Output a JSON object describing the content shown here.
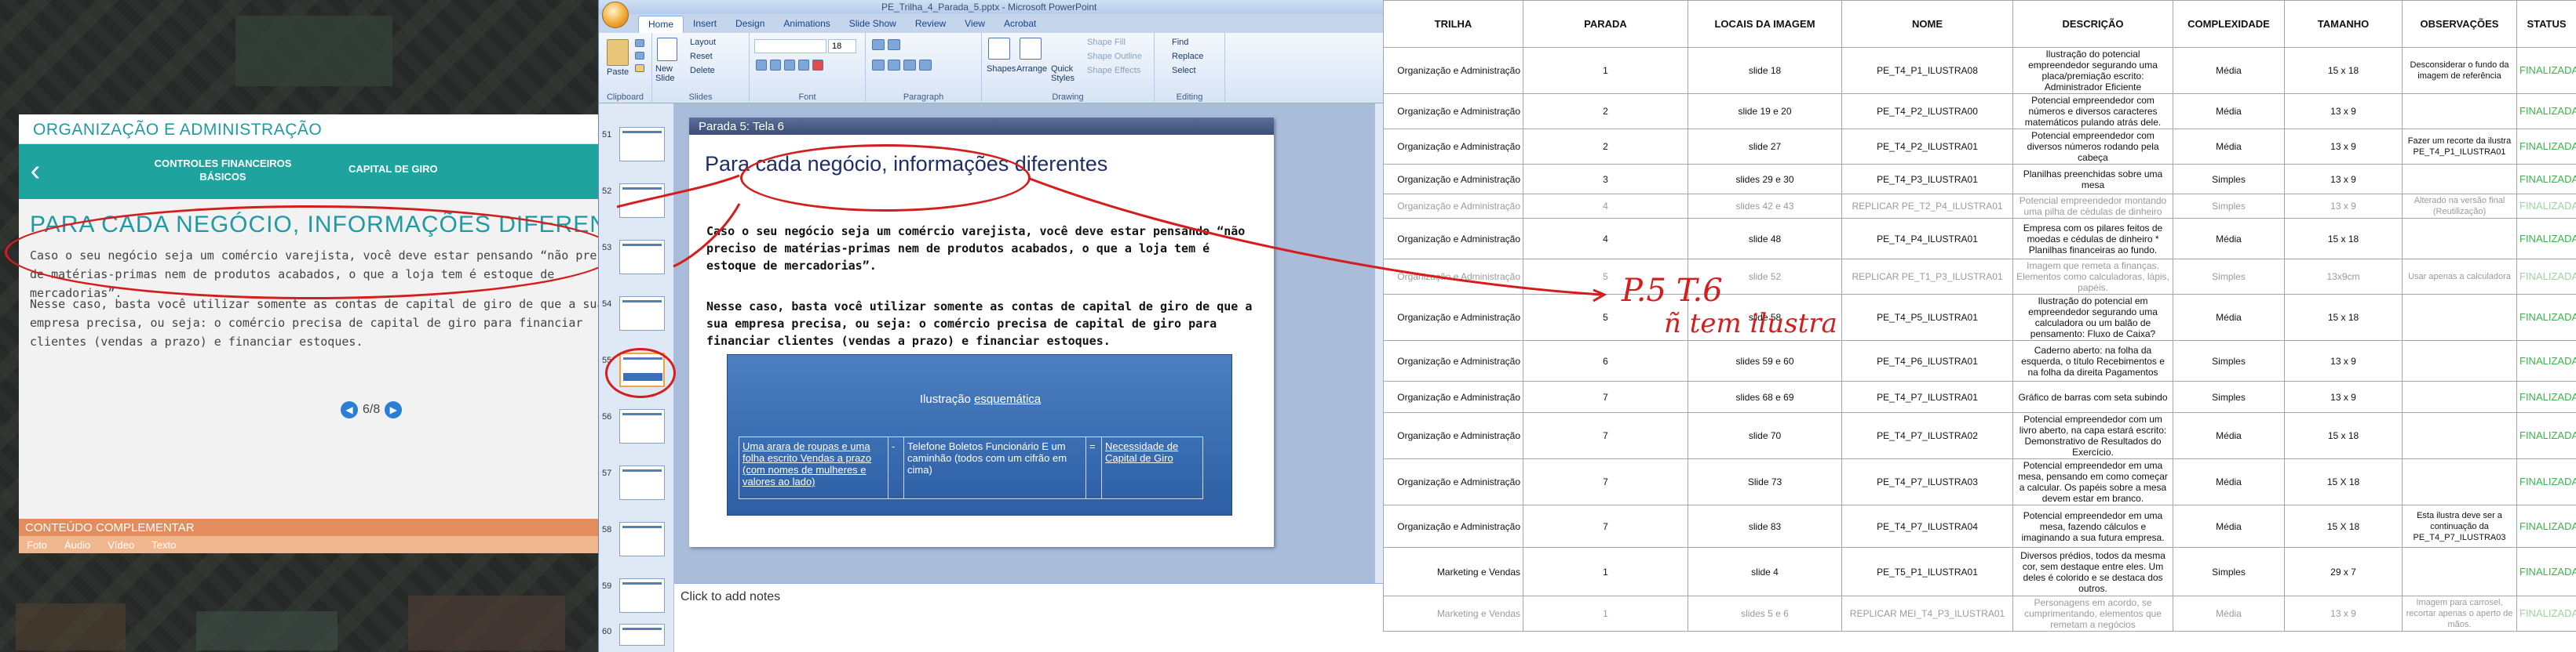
{
  "viewer": {
    "section_title": "ORGANIZAÇÃO E ADMINISTRAÇÃO",
    "nav_back": "‹",
    "nav_item1": "CONTROLES FINANCEIROS BÁSICOS",
    "nav_item2": "CAPITAL DE GIRO",
    "slide_title": "PARA CADA NEGÓCIO, INFORMAÇÕES DIFERENTES",
    "para1": "Caso o seu negócio seja um comércio varejista, você deve estar pensando “não preciso de matérias-primas nem de produtos acabados, o que a loja tem é estoque de mercadorias”.",
    "para2": "Nesse caso, basta você utilizar somente as contas de capital de giro de que a sua empresa precisa, ou seja: o comércio precisa de capital de giro para financiar clientes (vendas a prazo) e financiar estoques.",
    "pager_prev": "◀",
    "pager_text": "6/8",
    "pager_next": "▶",
    "footer_label": "CONTEÚDO COMPLEMENTAR",
    "footer_items": [
      "Foto",
      "Áudio",
      "Vídeo",
      "Texto"
    ]
  },
  "ppt": {
    "window_title": "PE_Trilha_4_Parada_5.pptx - Microsoft PowerPoint",
    "tabs": [
      "Home",
      "Insert",
      "Design",
      "Animations",
      "Slide Show",
      "Review",
      "View",
      "Acrobat"
    ],
    "groups": [
      "Clipboard",
      "Slides",
      "Font",
      "Paragraph",
      "Drawing",
      "Editing"
    ],
    "ribbon": {
      "paste": "Paste",
      "new_slide": "New Slide",
      "layout": "Layout",
      "reset": "Reset",
      "delete": "Delete",
      "font_size": "18",
      "shapes": "Shapes",
      "arrange": "Arrange",
      "quick_styles": "Quick Styles",
      "shape_fill": "Shape Fill",
      "shape_outline": "Shape Outline",
      "shape_effects": "Shape Effects",
      "find": "Find",
      "replace": "Replace",
      "select": "Select"
    },
    "thumb_numbers": [
      "51",
      "52",
      "53",
      "54",
      "55",
      "56",
      "57",
      "58",
      "59",
      "60"
    ],
    "slide": {
      "bar_title": "Parada 5: Tela 6",
      "title": "Para cada negócio, informações diferentes",
      "para1": "Caso o seu negócio seja um comércio varejista, você deve estar pensando “não preciso de matérias-primas nem de produtos acabados, o que a loja tem é estoque de mercadorias”.",
      "para2": "Nesse caso, basta você utilizar somente as contas de capital de giro de que a sua empresa precisa, ou seja: o comércio precisa de capital de giro para financiar clientes (vendas a prazo) e financiar estoques.",
      "illu_prefix": "Ilustração",
      "illu_word": "esquemática",
      "cell1": "Uma arara de roupas e uma folha escrito Vendas a prazo (com nomes de mulheres e valores ao lado)",
      "cell2": "-",
      "cell3": "Telefone Boletos Funcionário E um caminhão (todos com um cifrão em cima)",
      "cell4": "=",
      "cell5": "Necessidade de Capital de Giro"
    },
    "notes_placeholder": "Click to add notes"
  },
  "sheet": {
    "headers": [
      "TRILHA",
      "PARADA",
      "LOCAIS DA IMAGEM",
      "NOME",
      "DESCRIÇÃO",
      "COMPLEXIDADE",
      "TAMANHO",
      "OBSERVAÇÕES",
      "STATUS"
    ],
    "rows": [
      {
        "trilha": "Organização e Administração",
        "parada": "1",
        "locais": "slide 18",
        "nome": "PE_T4_P1_ILUSTRA08",
        "desc": "Ilustração do potencial empreendedor segurando uma placa/premiação escrito: Administrador Eficiente",
        "compl": "Média",
        "tam": "15 x 18",
        "obs": "Desconsiderar o fundo da imagem de referência",
        "status": "FINALIZADA",
        "gray": false,
        "h": 52
      },
      {
        "trilha": "Organização e Administração",
        "parada": "2",
        "locais": "slide 19 e 20",
        "nome": "PE_T4_P2_ILUSTRA00",
        "desc": "Potencial empreendedor com números e diversos caracteres matemáticos pulando atrás dele.",
        "compl": "Média",
        "tam": "13 x 9",
        "obs": "",
        "status": "FINALIZADA",
        "gray": false,
        "h": 40
      },
      {
        "trilha": "Organização e Administração",
        "parada": "2",
        "locais": "slide 27",
        "nome": "PE_T4_P2_ILUSTRA01",
        "desc": "Potencial empreendedor com diversos números rodando pela cabeça",
        "compl": "Média",
        "tam": "13 x 9",
        "obs": "Fazer um recorte da ilustra PE_T4_P1_ILUSTRA01",
        "status": "FINALIZADA",
        "gray": false,
        "h": 40
      },
      {
        "trilha": "Organização e Administração",
        "parada": "3",
        "locais": "slides 29 e 30",
        "nome": "PE_T4_P3_ILUSTRA01",
        "desc": "Planilhas preenchidas sobre uma mesa",
        "compl": "Simples",
        "tam": "13 x 9",
        "obs": "",
        "status": "FINALIZADA",
        "gray": false,
        "h": 38
      },
      {
        "trilha": "Organização e Administração",
        "parada": "4",
        "locais": "slides 42 e 43",
        "nome": "REPLICAR PE_T2_P4_ILUSTRA01",
        "desc": "Potencial empreendedor montando uma pilha de cédulas de dinheiro",
        "compl": "Simples",
        "tam": "13 x 9",
        "obs": "Alterado na versão final (Reutilização)",
        "status": "FINALIZADA",
        "gray": true,
        "h": 30
      },
      {
        "trilha": "Organização e Administração",
        "parada": "4",
        "locais": "slide 48",
        "nome": "PE_T4_P4_ILUSTRA01",
        "desc": "Empresa com os pilares feitos de moedas e cédulas de dinheiro * Planilhas financeiras ao fundo.",
        "compl": "Média",
        "tam": "15 x 18",
        "obs": "",
        "status": "FINALIZADA",
        "gray": false,
        "h": 52
      },
      {
        "trilha": "Organização e Administração",
        "parada": "5",
        "locais": "slide 52",
        "nome": "REPLICAR PE_T1_P3_ILUSTRA01",
        "desc": "Imagem que remeta a finanças. Elementos como calculadoras, lápis, papéis.",
        "compl": "Simples",
        "tam": "13x9cm",
        "obs": "Usar apenas a calculadora",
        "status": "FINALIZADA",
        "gray": true,
        "h": 42
      },
      {
        "trilha": "Organização e Administração",
        "parada": "5",
        "locais": "slide 58",
        "nome": "PE_T4_P5_ILUSTRA01",
        "desc": "Ilustração do potencial em empreendedor segurando uma calculadora ou um balão de pensamento: Fluxo de Caixa?",
        "compl": "Média",
        "tam": "15 x 18",
        "obs": "",
        "status": "FINALIZADA",
        "gray": false,
        "h": 54
      },
      {
        "trilha": "Organização e Administração",
        "parada": "6",
        "locais": "slides 59 e 60",
        "nome": "PE_T4_P6_ILUSTRA01",
        "desc": "Caderno aberto: na folha da esquerda, o título Recebimentos e na folha da direita Pagamentos",
        "compl": "Simples",
        "tam": "13 x 9",
        "obs": "",
        "status": "FINALIZADA",
        "gray": false,
        "h": 52
      },
      {
        "trilha": "Organização e Administração",
        "parada": "7",
        "locais": "slides 68 e 69",
        "nome": "PE_T4_P7_ILUSTRA01",
        "desc": "Gráfico de barras com seta subindo",
        "compl": "Simples",
        "tam": "13 x 9",
        "obs": "",
        "status": "FINALIZADA",
        "gray": false,
        "h": 40
      },
      {
        "trilha": "Organização e Administração",
        "parada": "7",
        "locais": "slide 70",
        "nome": "PE_T4_P7_ILUSTRA02",
        "desc": "Potencial empreendedor com um livro aberto, na capa estará escrito: Demonstrativo de Resultados do Exercício.",
        "compl": "Média",
        "tam": "15 x 18",
        "obs": "",
        "status": "FINALIZADA",
        "gray": false,
        "h": 58
      },
      {
        "trilha": "Organização e Administração",
        "parada": "7",
        "locais": "Slide 73",
        "nome": "PE_T4_P7_ILUSTRA03",
        "desc": "Potencial empreendedor em uma mesa, pensando em como começar a calcular. Os papéis sobre a mesa devem estar em branco.",
        "compl": "Média",
        "tam": "15 X 18",
        "obs": "",
        "status": "FINALIZADA",
        "gray": false,
        "h": 58
      },
      {
        "trilha": "Organização e Administração",
        "parada": "7",
        "locais": "slide 83",
        "nome": "PE_T4_P7_ILUSTRA04",
        "desc": "Potencial empreendedor em uma mesa, fazendo cálculos e imaginando a sua futura empresa.",
        "compl": "Média",
        "tam": "15 X 18",
        "obs": "Esta ilustra deve ser a continuação da PE_T4_P7_ILUSTRA03",
        "status": "FINALIZADA",
        "gray": false,
        "h": 54
      },
      {
        "trilha": "Marketing e Vendas",
        "parada": "1",
        "locais": "slide 4",
        "nome": "PE_T5_P1_ILUSTRA01",
        "desc": "Diversos prédios, todos da mesma cor, sem destaque entre eles. Um deles é colorido e se destaca dos outros.",
        "compl": "Simples",
        "tam": "29 x 7",
        "obs": "",
        "status": "FINALIZADA",
        "gray": false,
        "h": 62
      },
      {
        "trilha": "Marketing e Vendas",
        "parada": "1",
        "locais": "slides 5 e 6",
        "nome": "REPLICAR MEI_T4_P3_ILUSTRA01",
        "desc": "Personagens em acordo, se cumprimentando, elementos que remetam a negócios",
        "compl": "Média",
        "tam": "13 x 9",
        "obs": "Imagem para carrosel, recortar apenas o aperto de mãos.",
        "status": "FINALIZADA",
        "gray": true,
        "h": 40
      }
    ]
  },
  "annotations": {
    "handwritten_ref": "P.5 T.6",
    "handwritten_note": "ñ tem ilustra"
  }
}
